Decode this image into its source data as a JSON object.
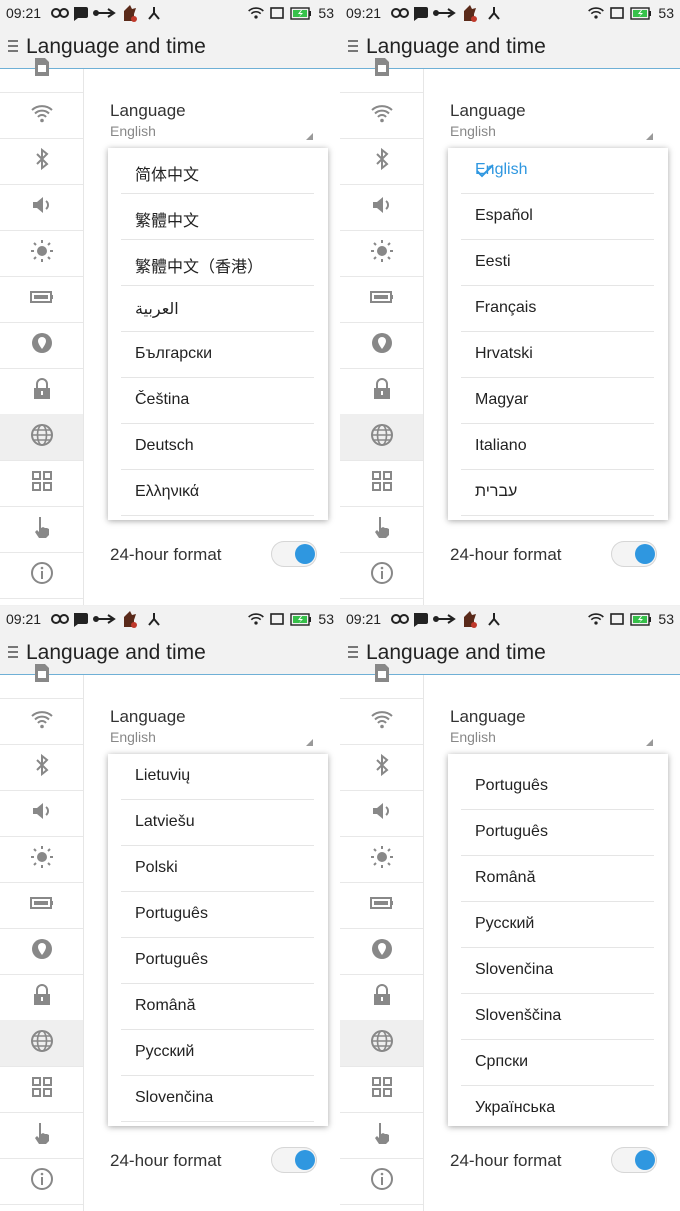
{
  "status_bar": {
    "time": "09:21",
    "battery": "53"
  },
  "header": {
    "title": "Language and time"
  },
  "language": {
    "label": "Language",
    "value": "English"
  },
  "hour_format": {
    "label": "24-hour format",
    "enabled": true
  },
  "accent_color": "#2f97e0",
  "sidebar_icons": [
    "sim-icon",
    "wifi-icon",
    "bluetooth-icon",
    "sound-icon",
    "brightness-icon",
    "battery-icon",
    "location-icon",
    "lock-icon",
    "globe-icon",
    "apps-grid-icon",
    "gesture-icon",
    "info-icon"
  ],
  "panels": [
    {
      "options": [
        "简体中文",
        "繁體中文",
        "繁體中文（香港）",
        "العربية",
        "Български",
        "Čeština",
        "Deutsch",
        "Ελληνικά"
      ],
      "selected": null
    },
    {
      "options": [
        "English",
        "Español",
        "Eesti",
        "Français",
        "Hrvatski",
        "Magyar",
        "Italiano",
        "עברית"
      ],
      "selected": 0
    },
    {
      "options": [
        "Lietuvių",
        "Latviešu",
        "Polski",
        "Português",
        "Português",
        "Română",
        "Русский",
        "Slovenčina"
      ],
      "selected": null
    },
    {
      "options": [
        "Português",
        "Português",
        "Română",
        "Русский",
        "Slovenčina",
        "Slovenščina",
        "Српски",
        "Українська"
      ],
      "selected": null
    }
  ]
}
